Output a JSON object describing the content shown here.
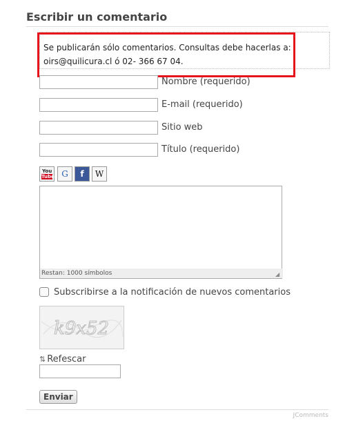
{
  "section": {
    "title": "Escribir un comentario"
  },
  "notice": {
    "line1": "Se publicarán sólo comentarios. Consultas debe hacerlas a:",
    "line2": "oirs@quilicura.cl ó 02- 366 67 04."
  },
  "fields": {
    "name": {
      "label": "Nombre (requerido)",
      "value": ""
    },
    "email": {
      "label": "E-mail (requerido)",
      "value": ""
    },
    "website": {
      "label": "Sitio web",
      "value": ""
    },
    "title": {
      "label": "Título (requerido)",
      "value": ""
    }
  },
  "bbcode": {
    "youtube_top": "You",
    "youtube_bottom": "Tube",
    "google": "G",
    "facebook": "f",
    "wikipedia": "W"
  },
  "comment": {
    "value": "",
    "counter": "Restan: 1000 símbolos"
  },
  "subscribe": {
    "label": "Subscribirse a la notificación de nuevos comentarios",
    "checked": false
  },
  "captcha": {
    "text": "k9x52",
    "refresh_label": "Refescar",
    "value": ""
  },
  "submit": {
    "label": "Enviar"
  },
  "footer": {
    "credit": "JComments"
  }
}
